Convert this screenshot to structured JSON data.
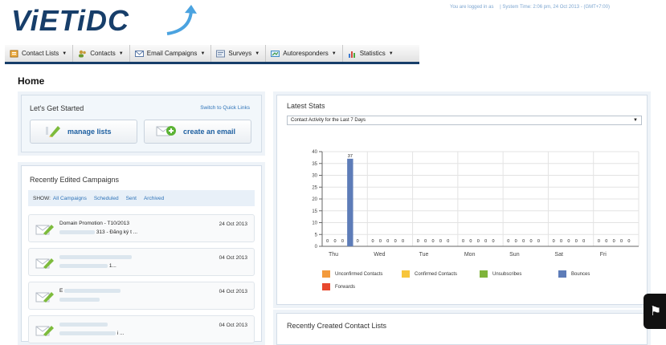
{
  "app": {
    "logo_text": "ViETiDC"
  },
  "topinfo": {
    "logged_in": "You are logged in as",
    "system_time": "| System Time: 2:06 pm, 24 Oct 2013 - (GMT+7:00)"
  },
  "nav": [
    {
      "label": "Contact Lists",
      "icon": "clipboard-icon"
    },
    {
      "label": "Contacts",
      "icon": "users-icon"
    },
    {
      "label": "Email Campaigns",
      "icon": "envelope-icon"
    },
    {
      "label": "Surveys",
      "icon": "survey-icon"
    },
    {
      "label": "Autoresponders",
      "icon": "autoresponder-icon"
    },
    {
      "label": "Statistics",
      "icon": "bar-chart-icon"
    }
  ],
  "page": {
    "title": "Home"
  },
  "start": {
    "title": "Let's Get Started",
    "switch": "Switch to Quick Links",
    "btn_manage": "manage lists",
    "btn_create": "create an email"
  },
  "campaigns": {
    "title": "Recently Edited Campaigns",
    "show_label": "SHOW:",
    "filters": [
      "All Campaigns",
      "Scheduled",
      "Sent",
      "Archived"
    ],
    "items": [
      {
        "name": "Domain Promotion - T10/2013",
        "sub": "313 - Đăng ký t ...",
        "date": "24 Oct 2013"
      },
      {
        "name": "",
        "sub": "1...",
        "date": "04 Oct 2013"
      },
      {
        "name": "E",
        "sub": "",
        "date": "04 Oct 2013"
      },
      {
        "name": "",
        "sub": "i ...",
        "date": "04 Oct 2013"
      }
    ]
  },
  "stats": {
    "title": "Latest Stats",
    "select_value": "Contact Activity for the Last 7 Days"
  },
  "lists": {
    "title": "Recently Created Contact Lists"
  },
  "colors": {
    "navy": "#173e6a",
    "bar": "#5d7cb8",
    "unconfirmed": "#f39a3c",
    "confirmed": "#f7c53b",
    "unsubscribes": "#7fb43b",
    "bounces": "#5d7cb8",
    "forwards": "#e8482e"
  },
  "chart_data": {
    "type": "bar",
    "categories": [
      "Thu",
      "Wed",
      "Tue",
      "Mon",
      "Sun",
      "Sat",
      "Fri"
    ],
    "series": [
      {
        "name": "Unconfirmed Contacts",
        "values": [
          0,
          0,
          0,
          0,
          0,
          0,
          0
        ]
      },
      {
        "name": "Confirmed Contacts",
        "values": [
          0,
          0,
          0,
          0,
          0,
          0,
          0
        ]
      },
      {
        "name": "Unsubscribes",
        "values": [
          0,
          0,
          0,
          0,
          0,
          0,
          0
        ]
      },
      {
        "name": "Bounces",
        "values": [
          37,
          0,
          0,
          0,
          0,
          0,
          0
        ]
      },
      {
        "name": "Forwards",
        "values": [
          0,
          0,
          0,
          0,
          0,
          0,
          0
        ]
      }
    ],
    "ylim": [
      0,
      40
    ],
    "yticks": [
      0,
      5,
      10,
      15,
      20,
      25,
      30,
      35,
      40
    ],
    "grid": true,
    "legend_position": "bottom"
  }
}
